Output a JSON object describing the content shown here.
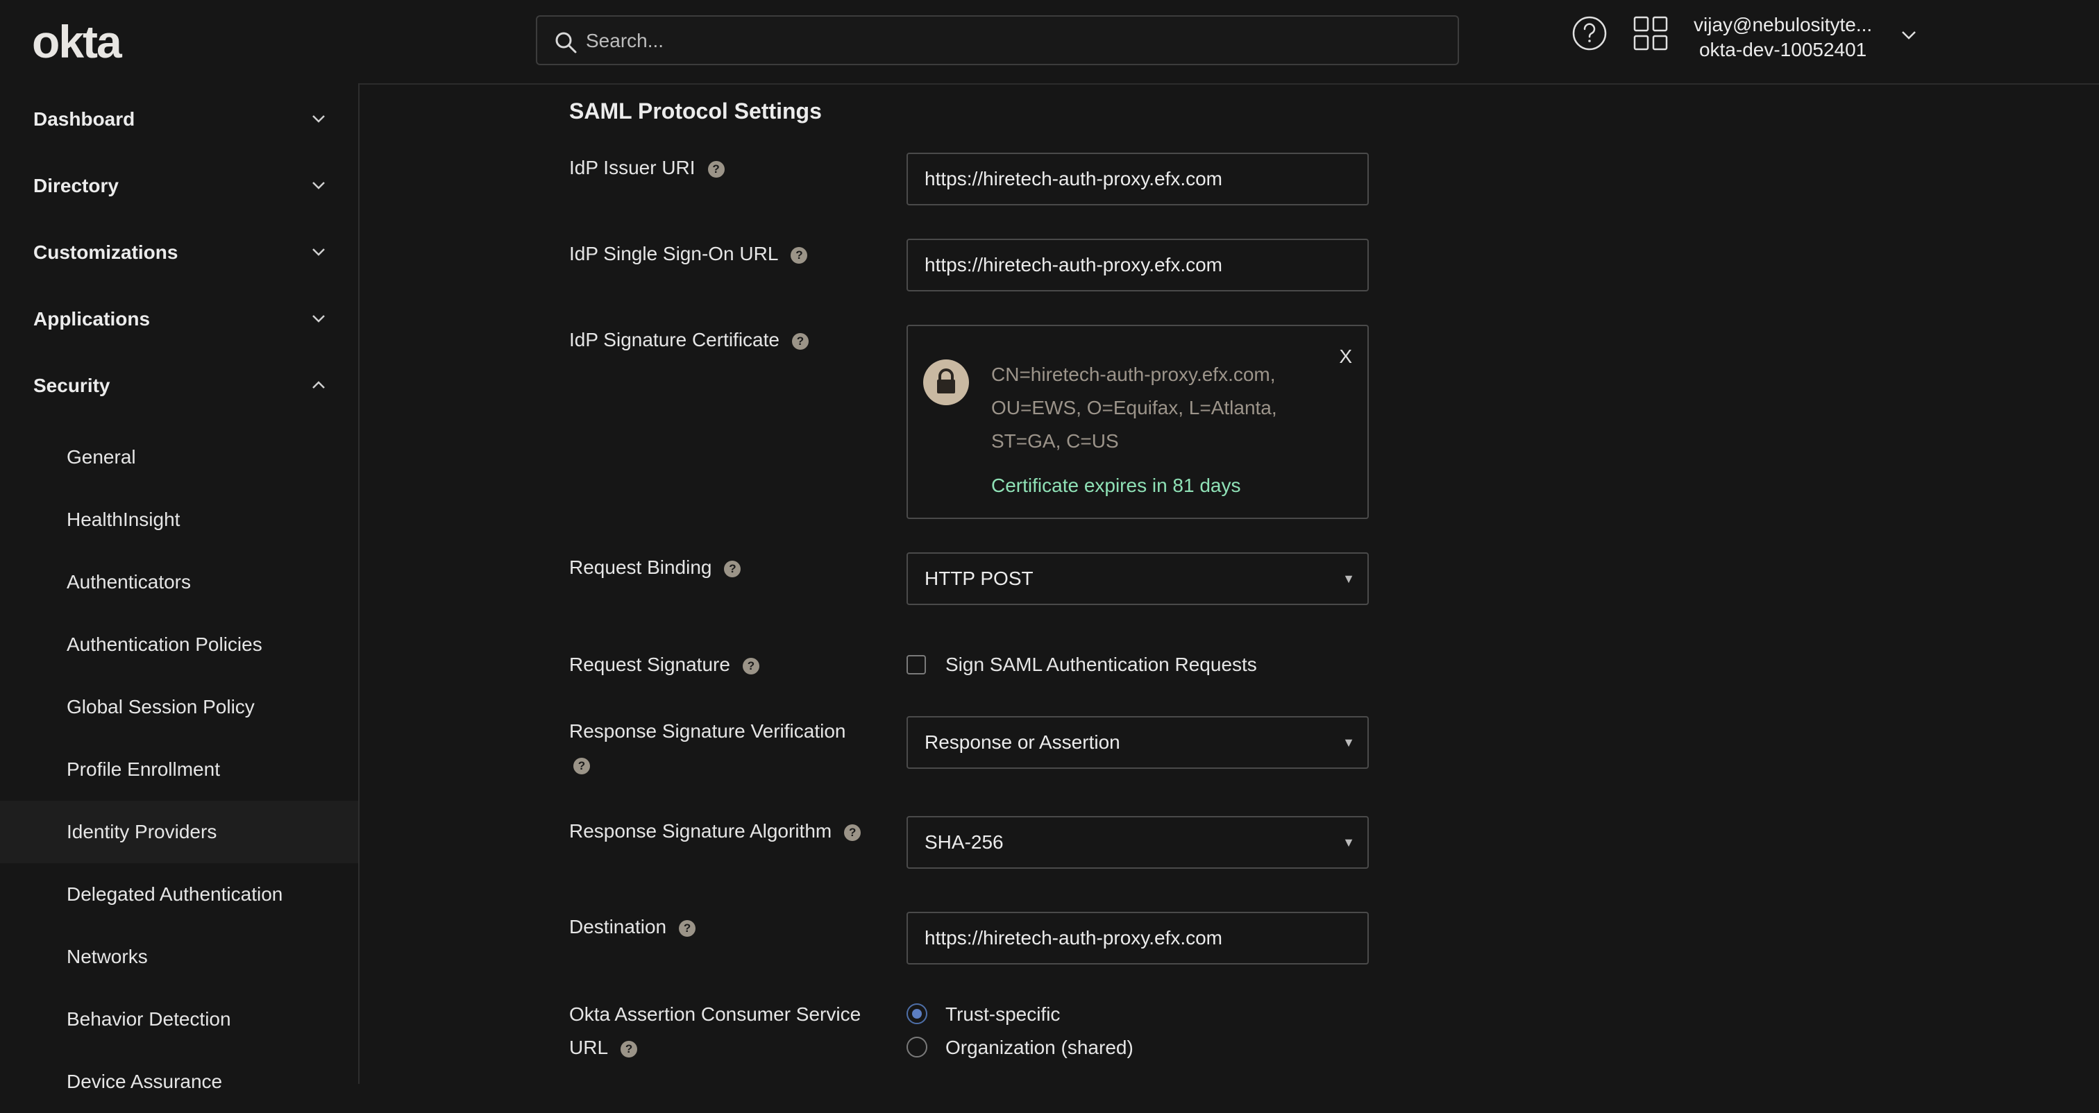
{
  "header": {
    "logo": "okta",
    "search_placeholder": "Search...",
    "user_email": "vijay@nebulosityte...",
    "org": "okta-dev-10052401"
  },
  "sidebar": {
    "top_items": [
      {
        "label": "Dashboard",
        "expanded": false
      },
      {
        "label": "Directory",
        "expanded": false
      },
      {
        "label": "Customizations",
        "expanded": false
      },
      {
        "label": "Applications",
        "expanded": false
      },
      {
        "label": "Security",
        "expanded": true
      }
    ],
    "security_items": [
      "General",
      "HealthInsight",
      "Authenticators",
      "Authentication Policies",
      "Global Session Policy",
      "Profile Enrollment",
      "Identity Providers",
      "Delegated Authentication",
      "Networks",
      "Behavior Detection",
      "Device Assurance"
    ],
    "active_item": "Identity Providers"
  },
  "main": {
    "section_title": "SAML Protocol Settings",
    "idp_issuer_uri": {
      "label": "IdP Issuer URI",
      "value": "https://hiretech-auth-proxy.efx.com"
    },
    "idp_sso_url": {
      "label": "IdP Single Sign-On URL",
      "value": "https://hiretech-auth-proxy.efx.com"
    },
    "idp_cert": {
      "label": "IdP Signature Certificate",
      "subject_line1": "CN=hiretech-auth-proxy.efx.com,",
      "subject_line2": "OU=EWS, O=Equifax, L=Atlanta,",
      "subject_line3": "ST=GA, C=US",
      "expiry": "Certificate expires in 81 days",
      "close": "X"
    },
    "request_binding": {
      "label": "Request Binding",
      "value": "HTTP POST"
    },
    "request_signature": {
      "label": "Request Signature",
      "checkbox_label": "Sign SAML Authentication Requests",
      "checked": false
    },
    "response_sig_verification": {
      "label": "Response Signature Verification",
      "value": "Response or Assertion"
    },
    "response_sig_algorithm": {
      "label": "Response Signature Algorithm",
      "value": "SHA-256"
    },
    "destination": {
      "label": "Destination",
      "value": "https://hiretech-auth-proxy.efx.com"
    },
    "acs_url": {
      "label_line1": "Okta Assertion Consumer Service",
      "label_line2": "URL",
      "options": [
        "Trust-specific",
        "Organization (shared)"
      ],
      "selected": "Trust-specific"
    }
  },
  "colors": {
    "background": "#161616",
    "accent_green": "#8fe1b6",
    "radio_blue": "#5c7ec2"
  }
}
